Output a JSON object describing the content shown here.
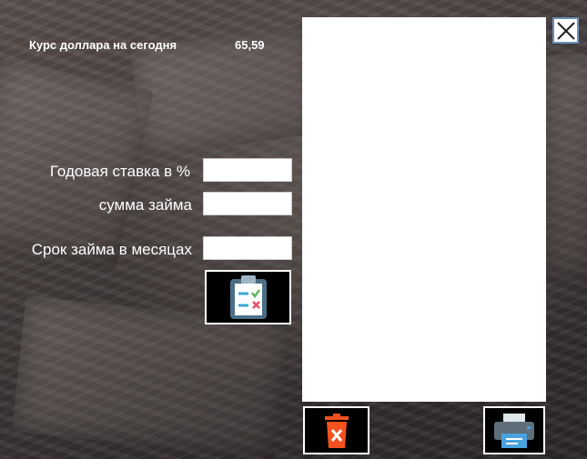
{
  "header": {
    "rate_label": "Курс доллара на сегодня",
    "rate_value": "65,59"
  },
  "form": {
    "annual_rate_label": "Годовая ставка в %",
    "annual_rate_value": "",
    "loan_amount_label": "сумма займа",
    "loan_amount_value": "",
    "loan_term_label": "Срок займа в месяцах",
    "loan_term_value": ""
  },
  "icons": {
    "calculate": "clipboard-checklist-icon",
    "close": "close-icon",
    "delete": "trash-icon",
    "print": "printer-icon"
  },
  "colors": {
    "delete_accent": "#f4511e",
    "clipboard_frame": "#4a6f86",
    "printer_blue": "#4aa3df"
  }
}
